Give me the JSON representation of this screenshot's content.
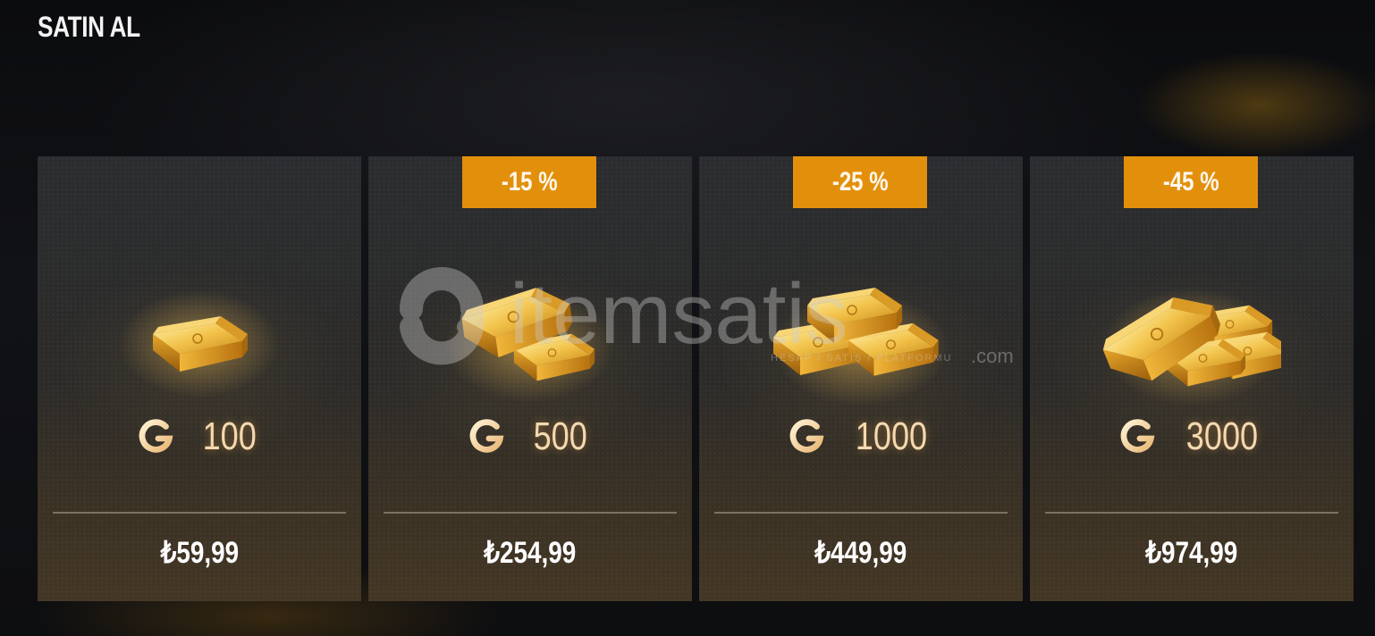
{
  "header": {
    "title": "SATIN AL"
  },
  "currency_icon": "g-coin-icon",
  "colors": {
    "badge": "#e2900c",
    "gold": "#f4d9b0"
  },
  "cards": [
    {
      "badge": "",
      "amount": "100",
      "price": "₺59,99",
      "art": "gold-bar-single-icon"
    },
    {
      "badge": "-15 %",
      "amount": "500",
      "price": "₺254,99",
      "art": "gold-bars-two-icon"
    },
    {
      "badge": "-25 %",
      "amount": "1000",
      "price": "₺449,99",
      "art": "gold-bars-stack-icon"
    },
    {
      "badge": "-45 %",
      "amount": "3000",
      "price": "₺974,99",
      "art": "gold-bars-pile-icon"
    }
  ],
  "watermark": {
    "brand": "itemsatis",
    "tagline": "HESAP / SATIŞ / PLATFORMU",
    "tld": ".com"
  }
}
